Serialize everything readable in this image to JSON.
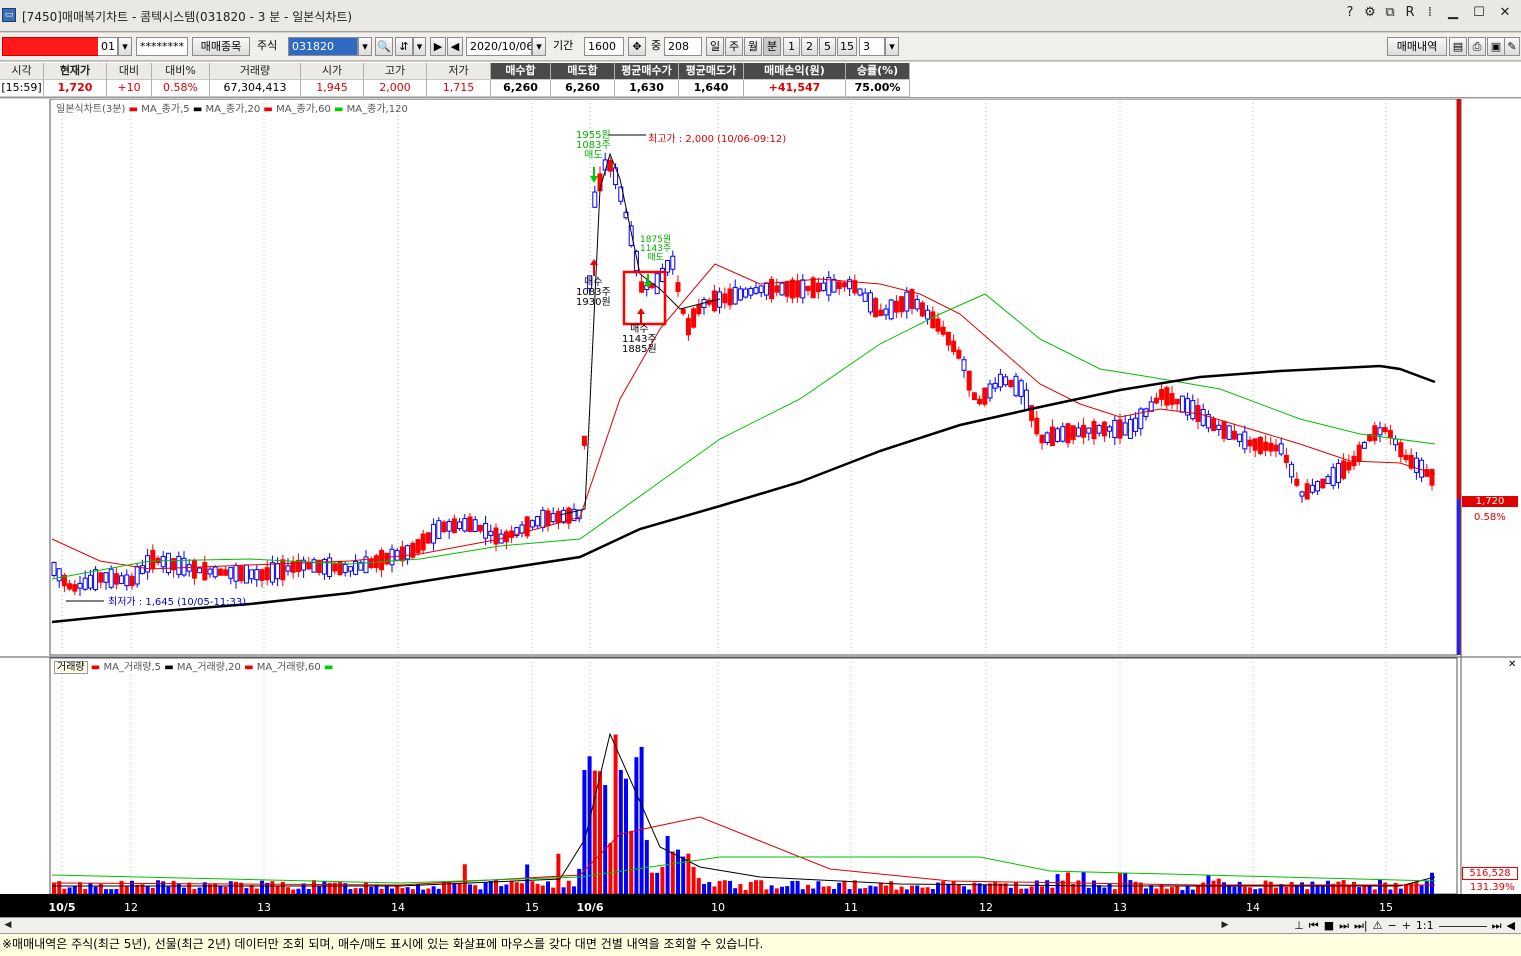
{
  "window": {
    "title": "[7450]매매복기차트 - 콤텍시스템(031820 - 3 분 - 일본식차트)",
    "controls": [
      "?",
      "?",
      "☐",
      "R",
      "⁞"
    ]
  },
  "toolbar": {
    "account_suffix": "01",
    "password": "********",
    "trade_item_button": "매매종목",
    "stock_label": "주식",
    "stock_code": "031820",
    "date": "2020/10/06",
    "period_label": "기간",
    "period_value": "1600",
    "count_label": "중",
    "count_value": "208",
    "unit_day": "일",
    "unit_week": "주",
    "unit_month": "월",
    "unit_minute": "분",
    "minutes": [
      "1",
      "2",
      "5",
      "15"
    ],
    "minute_value": "3",
    "trade_history_button": "매매내역"
  },
  "summary": {
    "headers": [
      "시각",
      "현재가",
      "대비",
      "대비%",
      "거래량",
      "시가",
      "고가",
      "저가",
      "매수합",
      "매도합",
      "평균매수가",
      "평균매도가",
      "매매손익(원)",
      "승률(%)"
    ],
    "values": [
      "[15:59]",
      "1,720",
      "+10",
      "0.58%",
      "67,304,413",
      "1,945",
      "2,000",
      "1,715",
      "6,260",
      "6,260",
      "1,630",
      "1,640",
      "+41,547",
      "75.00%"
    ]
  },
  "chart": {
    "price_legend": [
      "일본식차트(3분)",
      "MA_종가,5",
      "MA_종가,20",
      "MA_종가,60",
      "MA_종가,120"
    ],
    "volume_legend": [
      "거래량",
      "MA_거래량,5",
      "MA_거래량,20",
      "MA_거래량,60"
    ],
    "high_annotation": "최고가 : 2,000 (10/06-09:12)",
    "low_annotation": "최저가 : 1,645 (10/05-11:33)",
    "trade_marks": {
      "sell1_price": "1955원",
      "sell1_qty": "1083주",
      "sell1_type": "매도",
      "buy1_type": "매수",
      "buy1_qty": "1083주",
      "buy1_price": "1930원",
      "sell2_price": "1875원",
      "sell2_qty": "1143주",
      "sell2_type": "매도",
      "buy2_type": "매수",
      "buy2_qty": "1143주",
      "buy2_price": "1885원"
    },
    "current_price": "1,720",
    "current_pct": "0.58%",
    "current_volume": "516,528",
    "volume_pct": "131.39%",
    "x_labels": [
      "10/5",
      "12",
      "13",
      "14",
      "15",
      "10/6",
      "10",
      "11",
      "12",
      "13",
      "14",
      "15"
    ],
    "colors": {
      "up": "#ff0000",
      "down": "#0000ff",
      "ma5": "#000000",
      "ma20": "#e00000",
      "ma60": "#00c000",
      "ma120": "#000000",
      "trade_box": "#ff0000"
    }
  },
  "scroll": {
    "zoom_label": "1:1",
    "tools": [
      "⊥",
      "⏮",
      "■",
      "⏭",
      "⏭|",
      "⚠",
      "−",
      "+"
    ]
  },
  "status": {
    "message": "※매매내역은 주식(최근 5년), 선물(최근 2년) 데이터만 조회 되며, 매수/매도 표시에 있는 화살표에 마우스를 갖다 대면 건별 내역을 조회할 수 있습니다."
  }
}
